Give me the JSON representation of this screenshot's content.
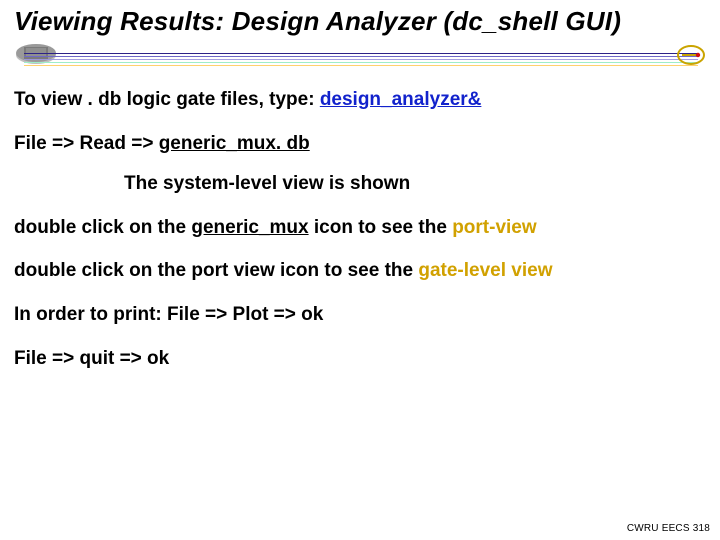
{
  "title": "Viewing Results: Design Analyzer (dc_shell GUI)",
  "lines": {
    "l1a": "To view . db logic gate files, type: ",
    "l1b": "design_analyzer&",
    "l2a": "File => Read => ",
    "l2b": "generic_mux. db",
    "l3": "The system-level view is shown",
    "l4a": "double click on the ",
    "l4b": "generic_mux",
    "l4c": " icon to see the ",
    "l4d": "port-view",
    "l5a": "double click on the port view icon to see the ",
    "l5b": "gate-level view",
    "l6": "In order to print: File => Plot => ok",
    "l7": "File => quit => ok"
  },
  "footer": "CWRU EECS 318"
}
